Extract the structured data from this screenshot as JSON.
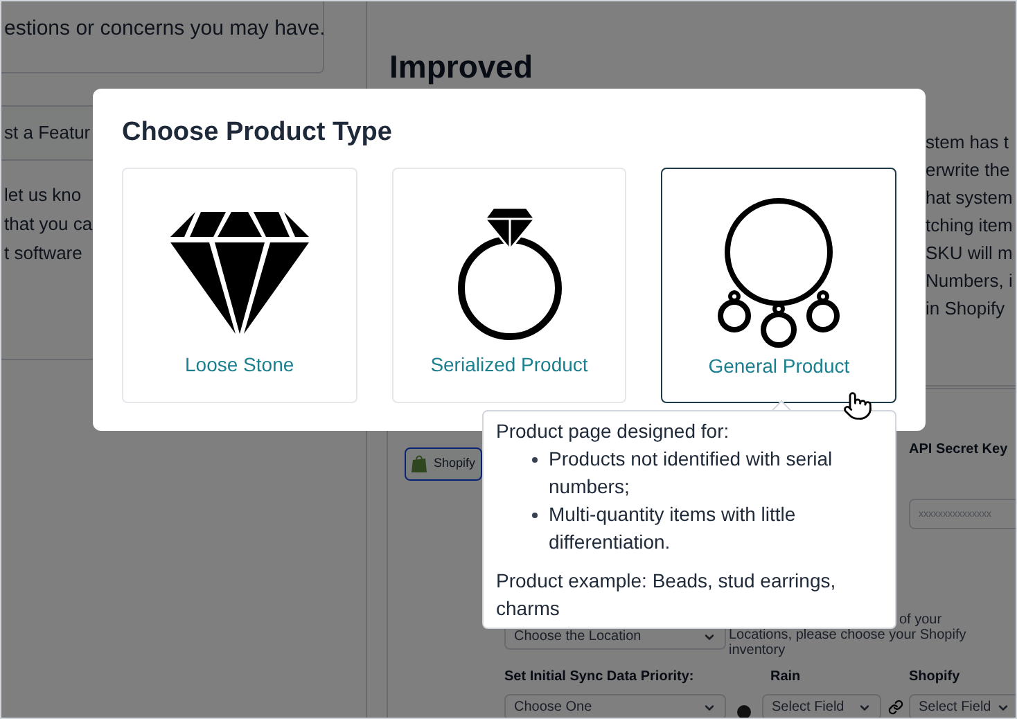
{
  "background": {
    "left_panel": {
      "top_text": "estions or concerns you may have.",
      "header": "st a Featur",
      "lines": [
        "let us kno",
        "that you ca",
        "t software"
      ]
    },
    "right_panel": {
      "heading": "Improved",
      "lines": [
        "stem has t",
        "erwrite the",
        "hat system",
        "tching item",
        "SKU will m",
        "Numbers, i",
        "in Shopify"
      ]
    },
    "integration": {
      "tab": {
        "label": "Shopify"
      },
      "api_secret_key": {
        "label": "API Secret Key",
        "placeholder": "xxxxxxxxxxxxxxx"
      },
      "location_select": {
        "value": "Choose the Location"
      },
      "location_note": [
        "of your",
        "Locations, please choose your Shopify",
        "inventory"
      ],
      "sync_priority": {
        "label": "Set Initial Sync Data Priority:",
        "value": "Choose One"
      },
      "mapping": {
        "rain_label": "Rain",
        "shopify_label": "Shopify",
        "rain_value": "Select Field",
        "shopify_value": "Select Field"
      }
    }
  },
  "modal": {
    "title": "Choose Product Type",
    "product_types": [
      {
        "kind": "diamond",
        "label": "Loose Stone",
        "selected": false
      },
      {
        "kind": "ring",
        "label": "Serialized Product",
        "selected": false
      },
      {
        "kind": "necklace",
        "label": "General Product",
        "selected": true
      }
    ]
  },
  "tooltip": {
    "heading": "Product page designed for:",
    "bullets": [
      "Products not identified with serial numbers;",
      "Multi-quantity items with little differentiation."
    ],
    "example": "Product example: Beads, stud earrings, charms"
  }
}
